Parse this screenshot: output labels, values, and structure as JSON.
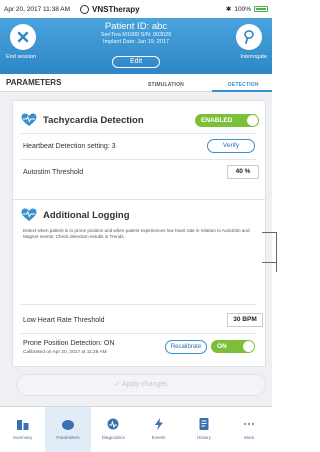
{
  "status_bar": {
    "date_time": "Apr 20, 2017   11:38 AM",
    "app_name": "VNSTherapy",
    "battery": "100%"
  },
  "header": {
    "patient_id": "Patient ID: abc",
    "device_line": "SenTiva M1000 S/N: 003029",
    "implant_line": "Implant Date: Jan 19, 2017",
    "edit_label": "Edit",
    "end_session_label": "End session",
    "interrogate_label": "Interrogate"
  },
  "section": {
    "title": "PARAMETERS",
    "tabs": [
      "STIMULATION",
      "DETECTION"
    ],
    "active_tab": "DETECTION"
  },
  "tachycardia": {
    "title": "Tachycardia Detection",
    "toggle_label": "ENABLED",
    "heartbeat_setting_label": "Heartbeat Detection setting: 3",
    "verify_label": "Verify",
    "autostim_label": "Autostim Threshold",
    "autostim_value": "40 %"
  },
  "logging": {
    "title": "Additional Logging",
    "description": "Detect when patient is in prone position and when patient experiences low heart rate in relation to AutoStim and Magnet events. Check detection results in Trends.",
    "low_hr_label": "Low Heart Rate Threshold",
    "low_hr_value": "30 BPM",
    "prone_label": "Prone Position Detection: ON",
    "prone_sub": "Calibrated on Apr 20, 2017 at 11:28 AM",
    "recalibrate_label": "Recalibrate",
    "prone_toggle_label": "ON"
  },
  "apply_label": "✓ Apply changes",
  "nav": [
    {
      "label": "Summary",
      "icon": "summary-icon"
    },
    {
      "label": "Parameters",
      "icon": "parameters-icon"
    },
    {
      "label": "Diagnostics",
      "icon": "diagnostics-icon"
    },
    {
      "label": "Events",
      "icon": "events-icon"
    },
    {
      "label": "History",
      "icon": "history-icon"
    },
    {
      "label": "More",
      "icon": "more-icon"
    }
  ],
  "colors": {
    "header_blue": "#2f86c6",
    "accent_blue": "#3a8fd0",
    "toggle_green": "#7cbf3a"
  }
}
